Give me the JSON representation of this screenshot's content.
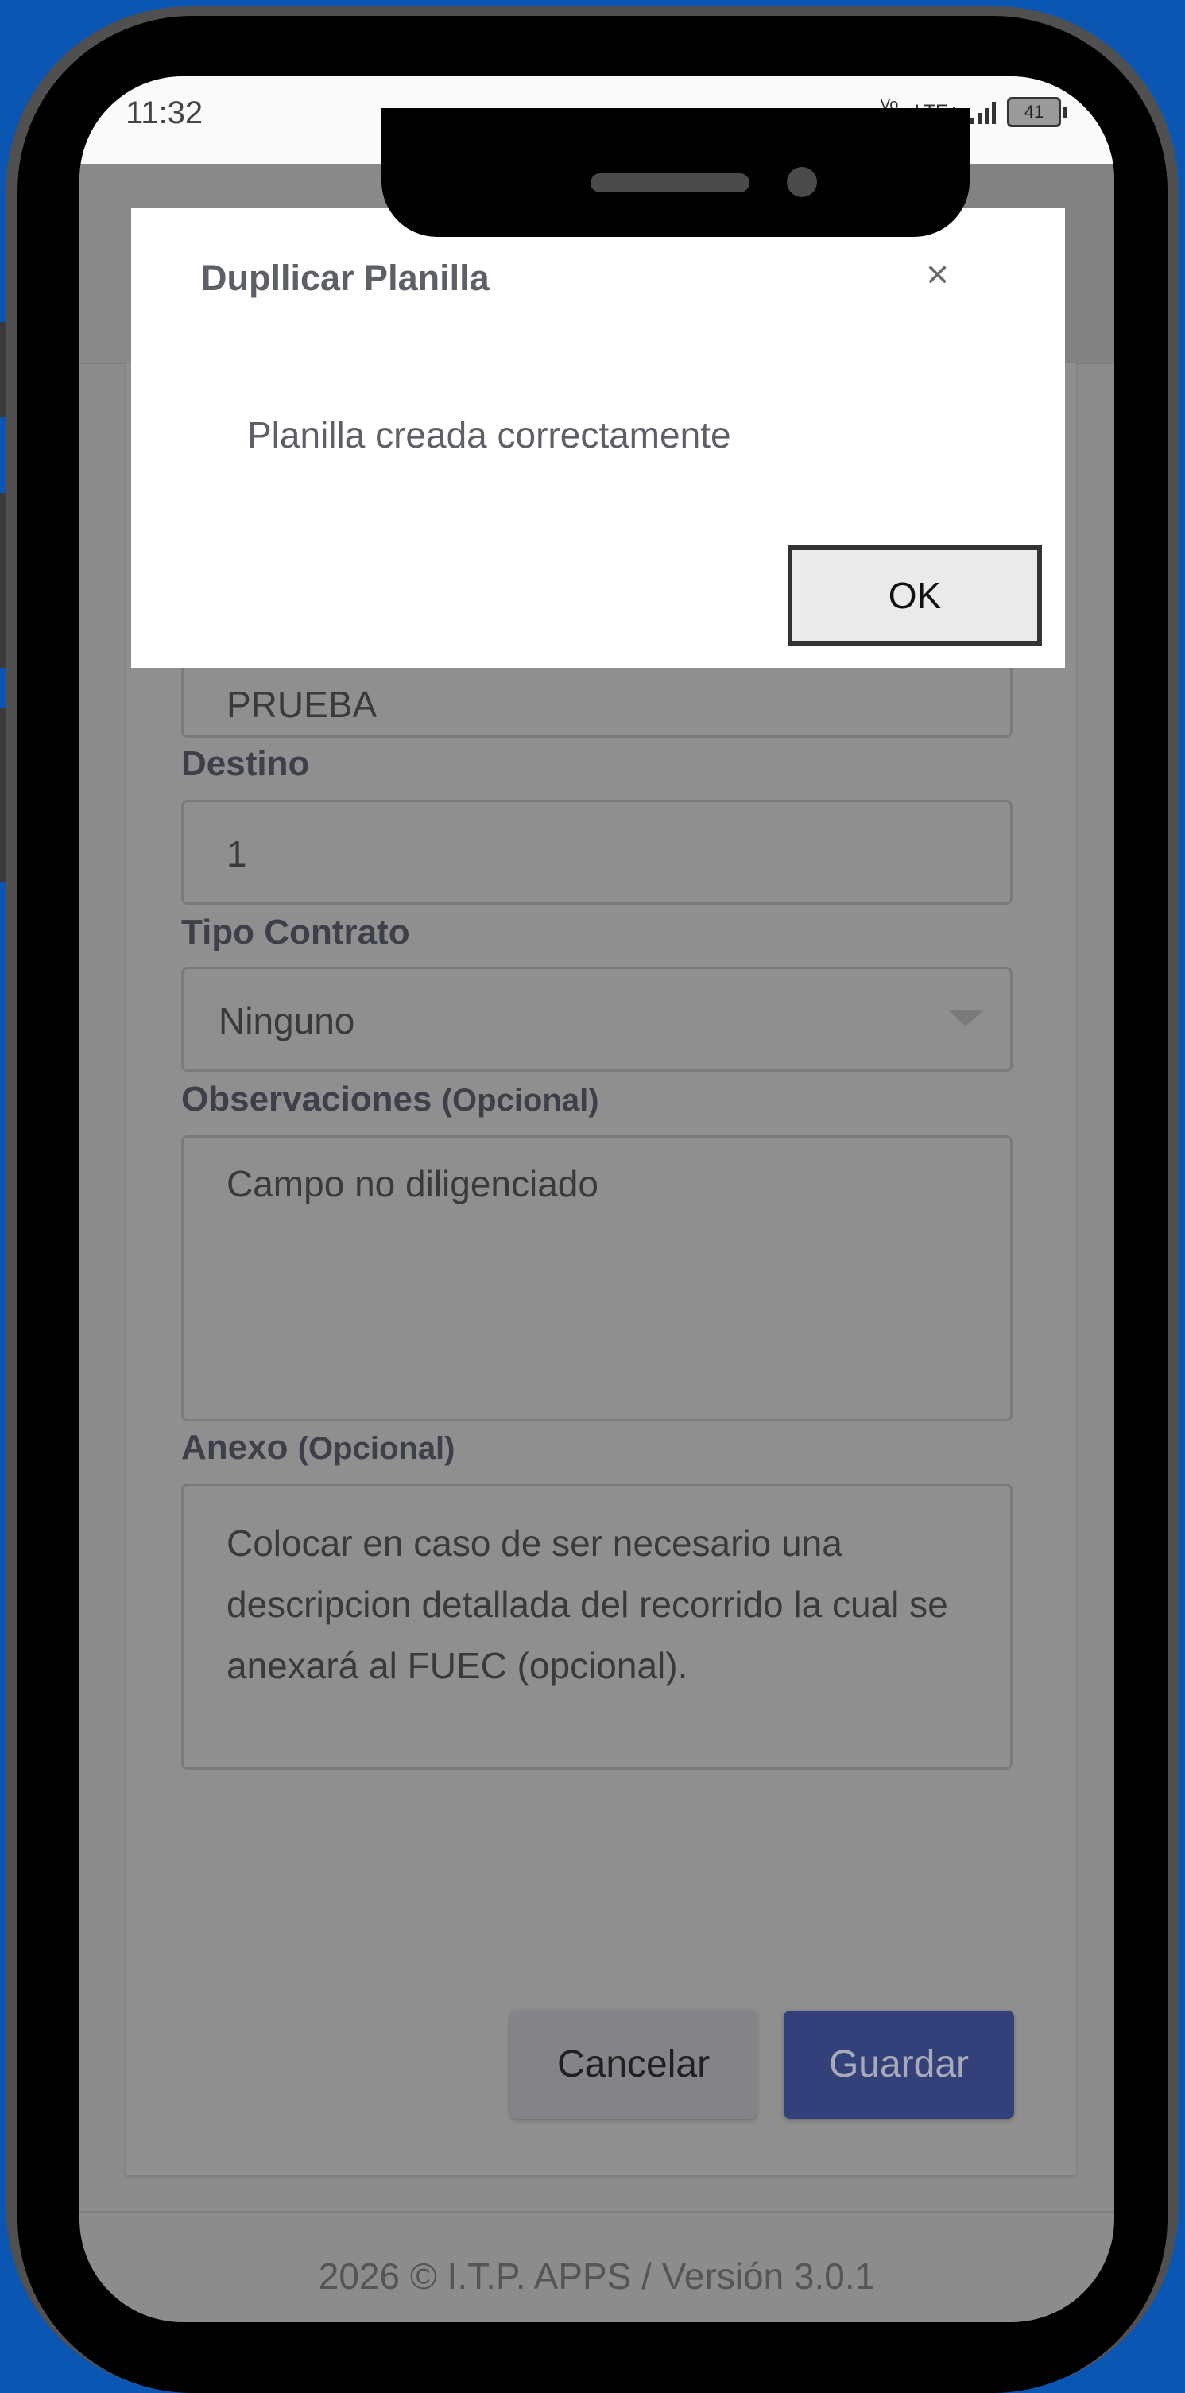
{
  "status_bar": {
    "time": "11:32",
    "volte": "Vo LTE",
    "network": "LTE+",
    "battery": "41"
  },
  "form": {
    "origen_value": "PRUEBA",
    "destino_label": "Destino",
    "destino_value": "1",
    "tipo_contrato_label": "Tipo Contrato",
    "tipo_contrato_value": "Ninguno",
    "observaciones_label": "Observaciones",
    "observaciones_optional": "(Opcional)",
    "observaciones_value": "Campo no diligenciado",
    "anexo_label": "Anexo",
    "anexo_optional": "(Opcional)",
    "anexo_placeholder": "Colocar en caso de ser necesario una descripcion detallada del recorrido la cual se anexará al FUEC (opcional)."
  },
  "actions": {
    "cancel_label": "Cancelar",
    "save_label": "Guardar"
  },
  "footer": {
    "text": "2026 © I.T.P. APPS / Versión 3.0.1"
  },
  "modal": {
    "title": "Dupllicar Planilla",
    "close_symbol": "×",
    "message": "Planilla creada correctamente",
    "ok_label": "OK"
  },
  "colors": {
    "background": "#0b56b3",
    "primary_button": "#33407a",
    "overlay": "#8c8c8c",
    "modal": "#ffffff"
  }
}
